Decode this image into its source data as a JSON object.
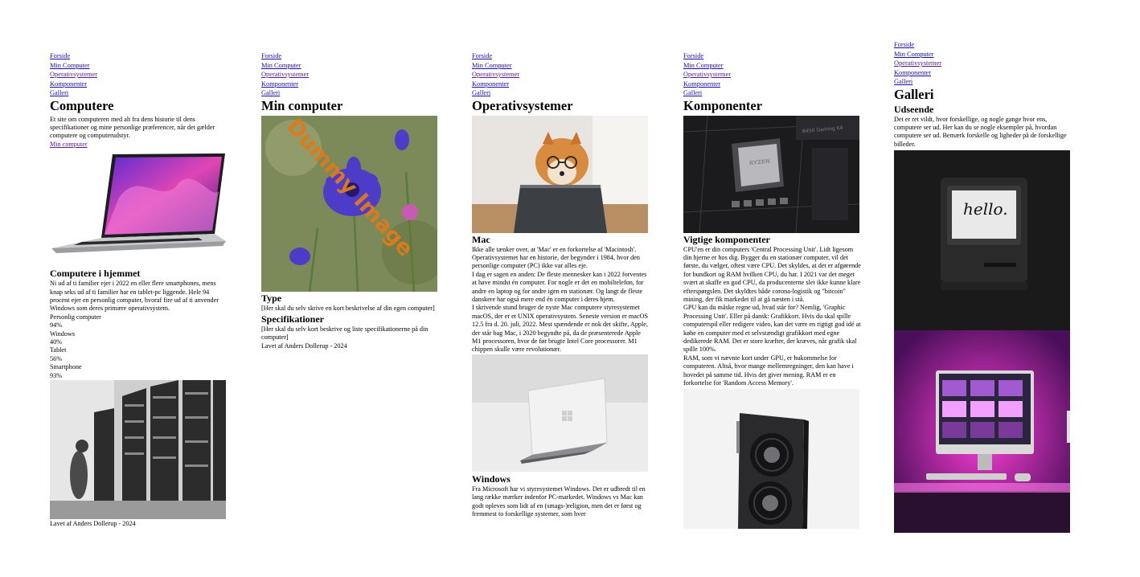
{
  "nav": [
    "Forside",
    "Min Computer",
    "Operativsystemer",
    "Komponenter",
    "Galleri"
  ],
  "p1": {
    "title": "Computere",
    "intro": "Et site om computeren med alt fra dens historie til dens specifikationer og mine personlige præferencer, når det gælder computere og computerudstyr.",
    "link": "Min computer",
    "h_home": "Computere i hjemmet",
    "text_home": "Ni ud af ti familier ejer i 2022 en eller flere smartphones, mens knap seks ud af ti familier har en tablet-pc liggende. Hele 94 procent ejer en personlig computer, hvoraf fire ud af ti anvender Windows som deres primære operativsystem.",
    "stats": [
      "Personlig computer",
      "94%",
      "Windows",
      "40%",
      "Tablet",
      "56%",
      "Smartphone",
      "93%"
    ],
    "footer": "Lavet af Anders Dollerup - 2024"
  },
  "p2": {
    "title": "Min computer",
    "watermark": "Dummy Image",
    "h_type": "Type",
    "text_type": "[Her skal du selv skrive en kort beskrivelse af din egen computer]",
    "h_spec": "Specifikationer",
    "text_spec": "[Her skal du selv kort beskrive og liste specifikationerne på din computer]",
    "footer": "Lavet af Anders Dollerup - 2024"
  },
  "p3": {
    "title": "Operativsystemer",
    "h_mac": "Mac",
    "text_mac1": "Ikke alle tænker over, at 'Mac' er en forkortelse af 'Macintosh'. Operativsystemet har en historie, der begynder i 1984, hvor den personlige computer (PC) ikke var alles eje.",
    "text_mac2": "I dag er sagen en anden: De fleste mennesker kan i 2022 forventes at have mindst én computer. For nogle er det en mobiltelefon, for andre en laptop og for andre igen en stationær. Og langt de fleste danskere har også mere end én computer i deres hjem.",
    "text_mac3": "I skrivende stund bruger de nyste Mac computere styresystemet macOS, der er et UNIX operativsystem. Seneste version er macOS 12.5 fra d. 20. juli, 2022. Mest spændende er nok det skifte, Apple, der står bag Mac, i 2020 begyndte på, da de præsenterede Apple M1 processoren, hvor de før brugte Intel Core processorer. M1 chippen skulle være revolutionær.",
    "h_win": "Windows",
    "text_win": "Fra Microsoft har vi styresystemet Windows. Det er udbredt til en lang række mærker indenfor PC-markedet. Windows vs Mac kan godt opleves som lidt af en (smags-)religion, men det er først og fremmest to forskellige systemer, som hver"
  },
  "p4": {
    "title": "Komponenter",
    "h_main": "Vigtige komponenter",
    "text_cpu": "CPU'en er din computers 'Central Processing Unit'. Lidt ligesom din hjerne er hos dig. Bygger du en stationær computer, vil det første, du vælger, oftest være CPU. Det skyldes, at det er afgørende for bundkort og RAM hvilken CPU, du har. I 2021 var det meget svært at skaffe en god CPU, da producenterne slet ikke kunne klare efterspørgslen. Det skyldtes både corona-logistik og \"bitcoin\" mining, der fik markedet til at gå næsten i stå.",
    "text_gpu": "GPU kan du måske regne ud, hvad står for? Nemlig, 'Graphic Processing Unit'. Eller på dansk: Grafikkort. Hvis du skal spille computerspil eller redigere video, kan det være en rigtigt god idé at købe en computer med et selvstændigt grafikkort med egne dedikerede RAM. Det er store kræfter, der kræves, når grafik skal spille 100%.",
    "text_ram": "RAM, som vi nævnte kort under GPU, er hukommelse for computeren. Altså, hvor mange mellemregninger, den kan have i hovedet på samme tid. Hvis det giver mening. RAM er en forkortelse for 'Random Access Memory'.",
    "board_label": "B450 Gaming K4",
    "chip_label": "RYZEN"
  },
  "p5": {
    "title": "Galleri",
    "h_look": "Udseende",
    "text_look": "Det er ret vildt, hvor forskellige, og nogle gange hvor ens, computere ser ud. Her kan du se nogle eksempler på, hvordan computere ser ud. Bemærk forskelle og ligheder på de forskellige billeder.",
    "hello": "hello."
  }
}
